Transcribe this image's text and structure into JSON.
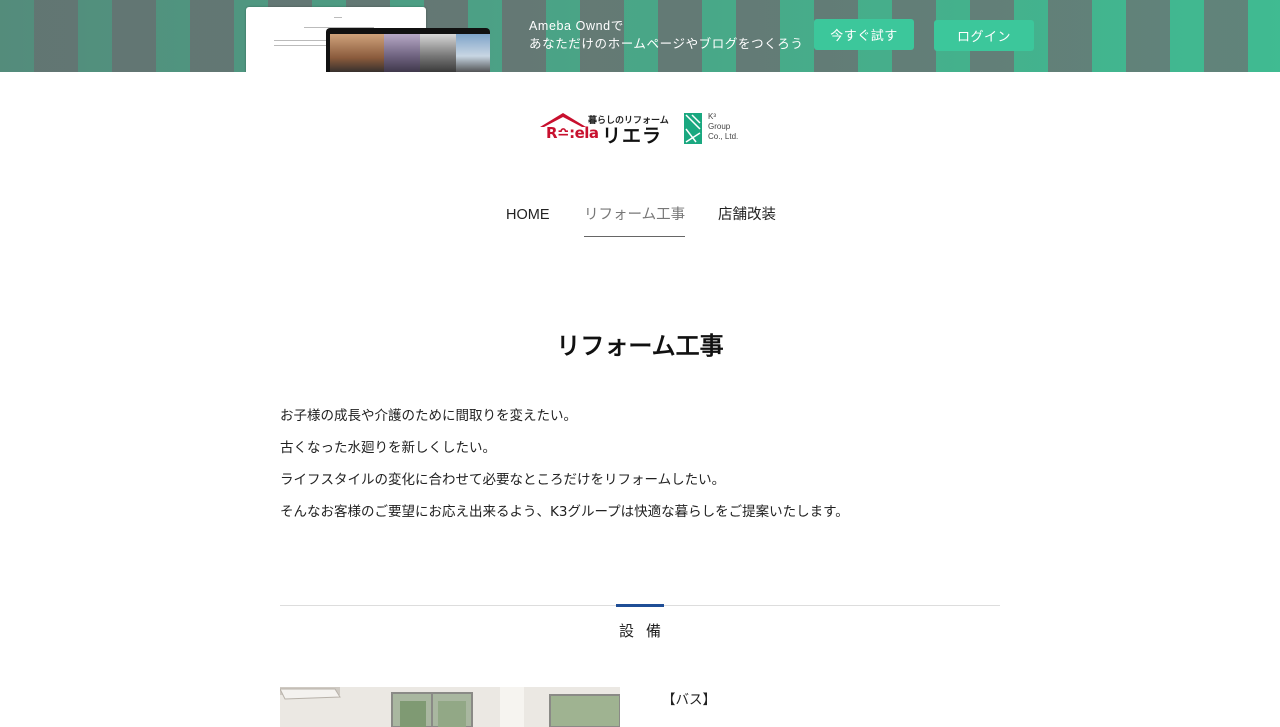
{
  "promo": {
    "line1": "Ameba Owndで",
    "line2": "あなただけのホームページやブログをつくろう",
    "try_button": "今すぐ試す",
    "login_button": "ログイン",
    "colors": {
      "accent": "#3cc79b",
      "stripe_dark": "#687b77"
    }
  },
  "logo": {
    "tagline": "暮らしのリフォーム",
    "brand": "R≏:ela",
    "brand_kana": "リエラ",
    "partner_mark": "K³",
    "partner_line1": "Group",
    "partner_line2": "Co., Ltd.",
    "colors": {
      "red": "#c8102e",
      "green": "#1aa880"
    }
  },
  "nav": {
    "items": [
      {
        "label": "HOME"
      },
      {
        "label": "リフォーム工事"
      },
      {
        "label": "店舗改装"
      }
    ],
    "active_index": 1
  },
  "page": {
    "title": "リフォーム工事",
    "intro": [
      "お子様の成長や介護のために間取りを変えたい。",
      "古くなった水廻りを新しくしたい。",
      "ライフスタイルの変化に合わせて必要なところだけをリフォームしたい。",
      "そんなお客様のご要望にお応え出来るよう、K3グループは快適な暮らしをご提案いたします。"
    ]
  },
  "section": {
    "title": "設備",
    "accent_color": "#1f4e96",
    "first_item_label": "【バス】"
  }
}
